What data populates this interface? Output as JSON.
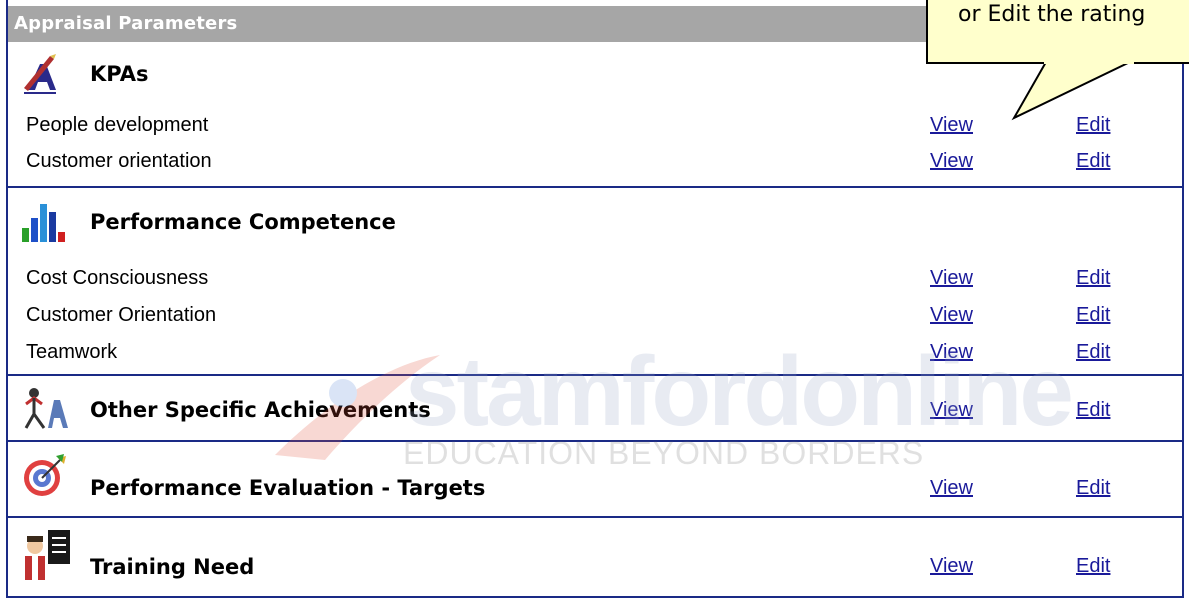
{
  "panel": {
    "header": "Appraisal Parameters"
  },
  "sections": [
    {
      "title": "KPAs",
      "icon": "kpa-pen-icon",
      "items": [
        {
          "label": "People development",
          "view": "View",
          "edit": "Edit"
        },
        {
          "label": "Customer orientation",
          "view": "View",
          "edit": "Edit"
        }
      ]
    },
    {
      "title": "Performance Competence",
      "icon": "bar-chart-icon",
      "items": [
        {
          "label": "Cost Consciousness",
          "view": "View",
          "edit": "Edit"
        },
        {
          "label": "Customer Orientation",
          "view": "View",
          "edit": "Edit"
        },
        {
          "label": "Teamwork",
          "view": "View",
          "edit": "Edit"
        }
      ]
    },
    {
      "title": "Other Specific Achievements",
      "icon": "achievement-figure-icon",
      "view": "View",
      "edit": "Edit"
    },
    {
      "title": "Performance Evaluation - Targets",
      "icon": "target-dart-icon",
      "view": "View",
      "edit": "Edit"
    },
    {
      "title": "Training Need",
      "icon": "trainer-board-icon",
      "view": "View",
      "edit": "Edit"
    }
  ],
  "callout": {
    "text": "or Edit the rating"
  },
  "watermark": {
    "brand": "stamfordonline",
    "tagline": "EDUCATION BEYOND BORDERS"
  },
  "colors": {
    "border": "#1a2a86",
    "header_bg": "#a6a6a6",
    "link": "#1a1a9a",
    "callout_bg": "#ffffcc"
  }
}
